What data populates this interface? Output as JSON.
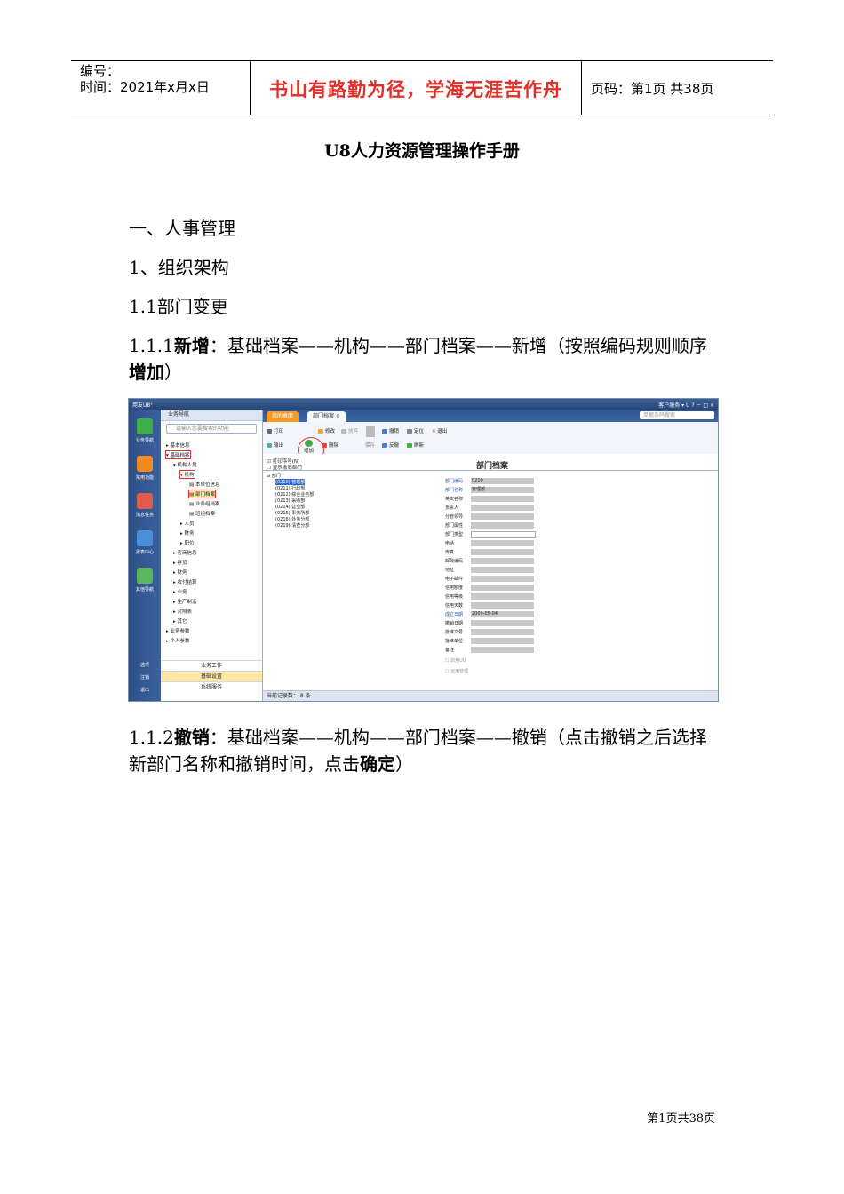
{
  "header": {
    "number_label": "编号：",
    "time_label": "时间：2021年x月x日",
    "motto": "书山有路勤为径，学海无涯苦作舟",
    "page_info": "页码：第1页 共38页"
  },
  "doc": {
    "title": "U8人力资源管理操作手册",
    "h1": "一、人事管理",
    "h2": "1、组织架构",
    "h3": "1.1部门变更",
    "p1_prefix": "1.1.1",
    "p1_bold": "新增",
    "p1_text": "：基础档案——机构——部门档案——新增（按照编码规则顺序",
    "p1_bold2": "增加",
    "p1_end": "）",
    "p2_prefix": "1.1.2",
    "p2_bold": "撤销",
    "p2_text": "：基础档案——机构——部门档案——撤销（点击撤销之后选择新部门名称和撤销时间，点击",
    "p2_bold2": "确定",
    "p2_end": "）",
    "footer": "第1页共38页"
  },
  "screenshot": {
    "app_title": "用友U8⁺",
    "window_tools": "客户服务 ▾  U  ?  －  □  ×",
    "left_nav": [
      "业务导航",
      "常用功能",
      "消息任务",
      "报表中心",
      "其他导航"
    ],
    "left_bottom": [
      "选项",
      "注销",
      "退出"
    ],
    "tree_header": "业务导航",
    "search_placeholder": "请输入您要搜索的功能",
    "tree_items": [
      "基本信息",
      "基础档案",
      "机构人员",
      "机构",
      "本单位信息",
      "部门档案",
      "业务组档案",
      "班组档案",
      "人员",
      "财务",
      "职位",
      "客商信息",
      "存货",
      "财务",
      "收付结算",
      "业务",
      "生产制造",
      "对照表",
      "其它",
      "业务参数",
      "个人参数"
    ],
    "tree_footer": [
      "业务工作",
      "基础设置",
      "系统服务"
    ],
    "tabs": [
      "我的桌面",
      "部门档案 ×"
    ],
    "search_box": "单据条码搜索",
    "toolbar": [
      "打印",
      "输出",
      "增加",
      "修改",
      "放弃",
      "删除",
      "保存",
      "撤销",
      "反撤",
      "定位",
      "刷新",
      "退出"
    ],
    "checkboxes": [
      "打印序号(N)",
      "显示撤消部门"
    ],
    "form_title": "部门档案",
    "dept_root": "部门",
    "depts": [
      "(0210) 管理部",
      "(0211) 行政部",
      "(0212) 综合业务部",
      "(0213) 采购部",
      "(0214) 营业部",
      "(0215) 事务所部",
      "(0216) 外务分部",
      "(0219) 清查分部"
    ],
    "fields": [
      "部门编码",
      "部门名称",
      "英文名称",
      "负责人",
      "分管领导",
      "部门属性",
      "部门类型",
      "电话",
      "传真",
      "邮政编码",
      "地址",
      "电子邮件",
      "信用额度",
      "信用等级",
      "信用天数",
      "成立日期",
      "撤销日期",
      "批准文号",
      "批准单位",
      "备注"
    ],
    "field_values": {
      "部门编码": "0210",
      "部门名称": "管理部",
      "成立日期": "2009-05-04"
    },
    "extra_checks": [
      "启用UU",
      "运用管理"
    ],
    "status": "当前记录数： 8 条"
  }
}
